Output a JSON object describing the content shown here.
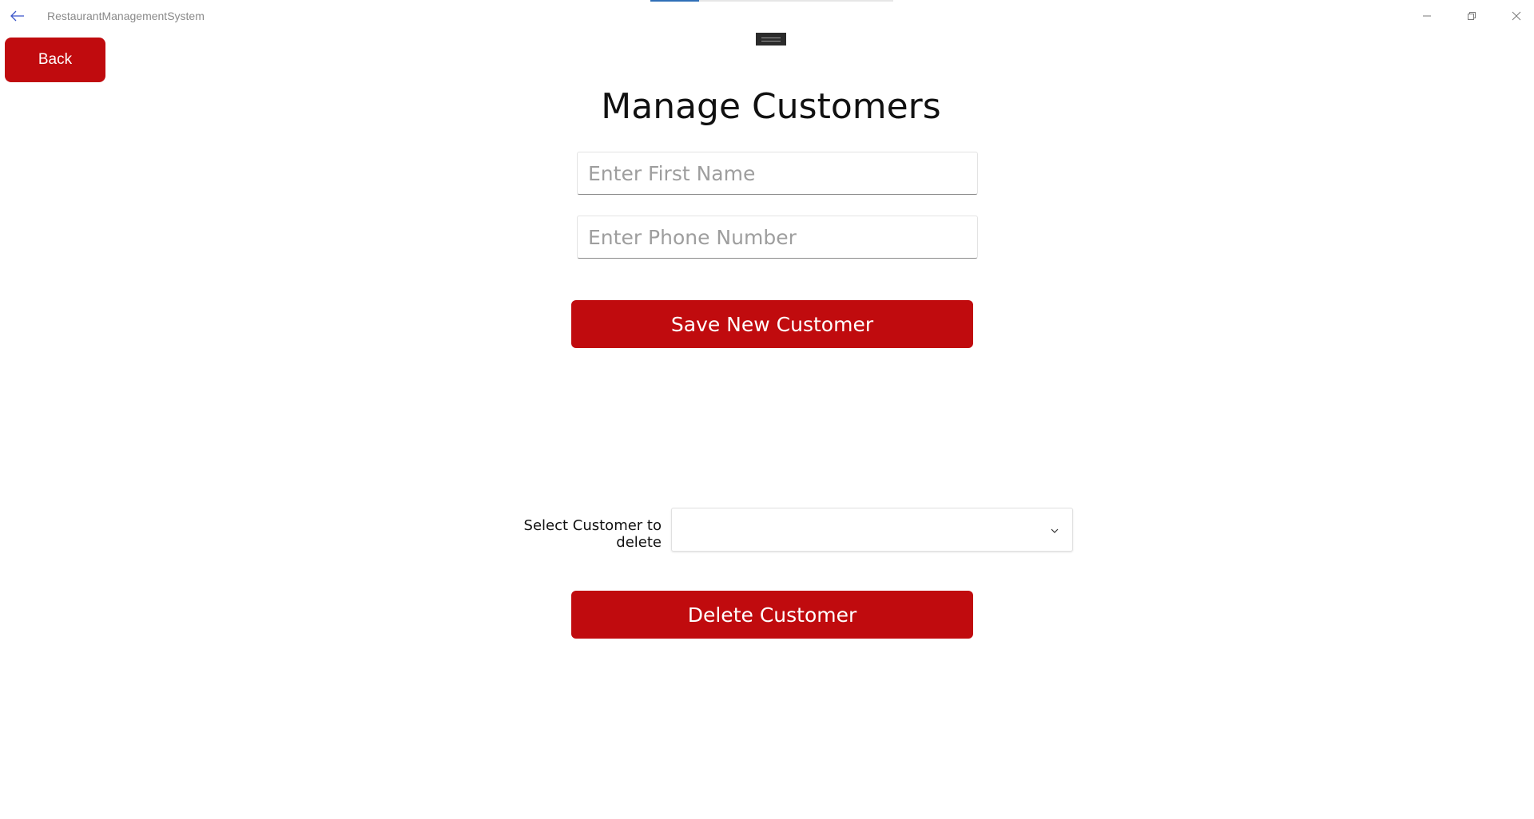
{
  "window": {
    "title": "RestaurantManagementSystem"
  },
  "titlebar": {
    "back_icon": "arrow-left-icon",
    "minimize_icon": "minimize-icon",
    "maximize_icon": "restore-icon",
    "close_icon": "close-icon"
  },
  "load_progress": 0.2,
  "back_button": {
    "label": "Back"
  },
  "page": {
    "title": "Manage Customers"
  },
  "form": {
    "first_name": {
      "value": "",
      "placeholder": "Enter First Name"
    },
    "phone": {
      "value": "",
      "placeholder": "Enter Phone Number"
    },
    "save_label": "Save New Customer"
  },
  "delete_section": {
    "label": "Select Customer to delete",
    "selected_value": "",
    "chevron_icon": "chevron-down-icon",
    "delete_label": "Delete Customer"
  },
  "colors": {
    "accent_red": "#c00b0e",
    "title_text": "#8a8a8a",
    "progress_blue": "#2f6fb7"
  }
}
